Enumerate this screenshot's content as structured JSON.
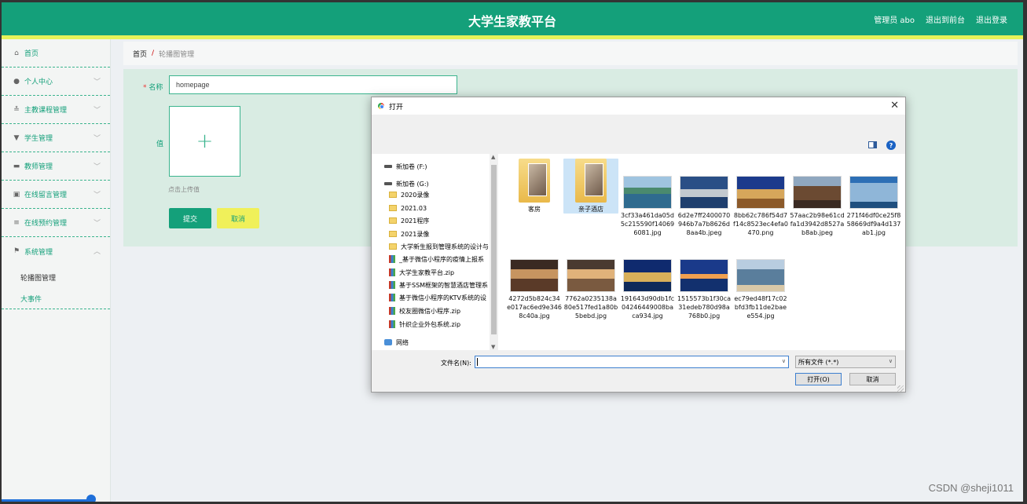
{
  "header": {
    "title": "大学生家教平台",
    "admin": "管理员 abo",
    "go_front": "退出到前台",
    "logout": "退出登录"
  },
  "sidebar": {
    "items": [
      {
        "label": "首页",
        "icon": "home-icon"
      },
      {
        "label": "个人中心",
        "icon": "user-icon"
      },
      {
        "label": "主教课程管理",
        "icon": "sliders-icon"
      },
      {
        "label": "学生管理",
        "icon": "pin-icon"
      },
      {
        "label": "教师管理",
        "icon": "briefcase-icon"
      },
      {
        "label": "在线留言管理",
        "icon": "calendar-icon"
      },
      {
        "label": "在线预约管理",
        "icon": "list-icon"
      },
      {
        "label": "系统管理",
        "icon": "flag-icon"
      }
    ],
    "sub_items": [
      "轮播图管理",
      "大事件"
    ]
  },
  "breadcrumb": {
    "home": "首页",
    "sep": "/",
    "current": "轮播图管理"
  },
  "form": {
    "name_label": "名称",
    "name_required": "*",
    "name_value": "homepage",
    "value_label": "值",
    "upload_plus": "+",
    "upload_hint": "点击上传值",
    "submit": "提交",
    "cancel": "取消"
  },
  "dialog": {
    "title": "打开",
    "close": "✕",
    "help": "?",
    "nav": [
      {
        "label": "新加卷 (F:)",
        "type": "drive"
      },
      {
        "label": "新加卷 (G:)",
        "type": "drive"
      },
      {
        "label": "2020录像",
        "type": "folder"
      },
      {
        "label": "2021.03",
        "type": "folder"
      },
      {
        "label": "2021程序",
        "type": "folder"
      },
      {
        "label": "2021录像",
        "type": "folder"
      },
      {
        "label": "大学新生报到管理系统的设计与",
        "type": "folder"
      },
      {
        "label": "_基于微信小程序的疫情上报系",
        "type": "rar"
      },
      {
        "label": "大学生家教平台.zip",
        "type": "rar"
      },
      {
        "label": "基于SSM框架的智慧酒店管理系",
        "type": "rar"
      },
      {
        "label": "基于微信小程序的KTV系统的设",
        "type": "rar"
      },
      {
        "label": "校友圈微信小程序.zip",
        "type": "rar"
      },
      {
        "label": "针织企业外包系统.zip",
        "type": "rar"
      },
      {
        "label": "网络",
        "type": "net"
      }
    ],
    "files": [
      {
        "name": "客房",
        "kind": "folder"
      },
      {
        "name": "亲子酒店",
        "kind": "folder"
      },
      {
        "name": "3cf33a461da05d5c215590f140696081.jpg",
        "kind": "t1"
      },
      {
        "name": "6d2e7ff2400070946b7a7b8626d8aa4b.jpeg",
        "kind": "t2"
      },
      {
        "name": "8bb62c786f54d7f14c8523ec4efa0470.png",
        "kind": "t3"
      },
      {
        "name": "57aac2b98e61cdfa1d3942d8527ab8ab.jpeg",
        "kind": "t4"
      },
      {
        "name": "271f46df0ce25f858669df9a4d137ab1.jpg",
        "kind": "t5"
      },
      {
        "name": "4272d5b824c34e017ac6ed9e3468c40a.jpg",
        "kind": "t6"
      },
      {
        "name": "7762a0235138a80e517fed1a80b5bebd.jpg",
        "kind": "t7"
      },
      {
        "name": "191643d90db1fc04246449008baca934.jpg",
        "kind": "t8"
      },
      {
        "name": "1515573b1f30ca31edeb780d98a768b0.jpg",
        "kind": "t9"
      },
      {
        "name": "ec79ed48f17c02bfd3fb11de2baee554.jpg",
        "kind": "t10"
      }
    ],
    "filename_label": "文件名(N):",
    "filename_value": "",
    "filter": "所有文件 (*.*)",
    "open": "打开(O)",
    "cancel": "取消"
  },
  "watermark": "CSDN @sheji1011"
}
